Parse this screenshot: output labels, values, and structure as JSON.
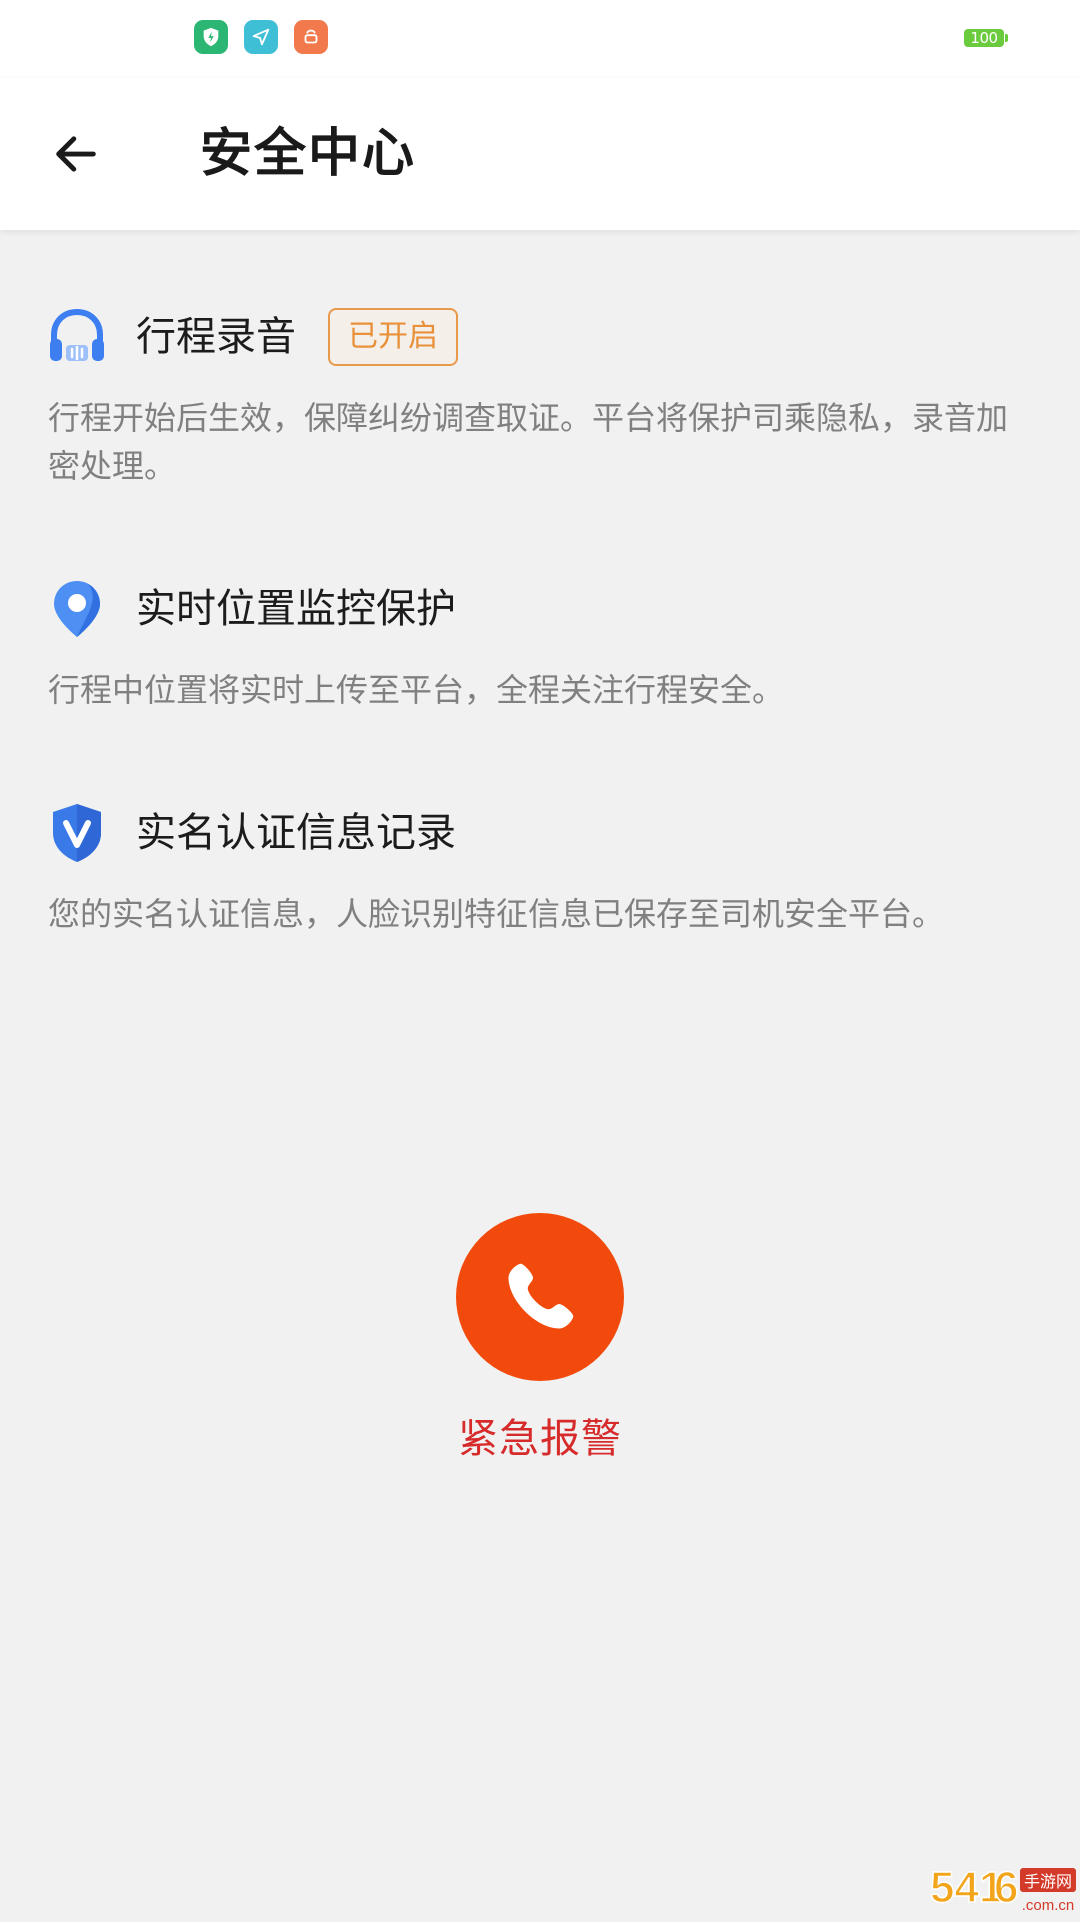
{
  "status_bar": {
    "battery_level": "100",
    "app_icons": [
      {
        "name": "shield-bolt-icon",
        "color": "#2bb673"
      },
      {
        "name": "send-icon",
        "color": "#3fbfd6"
      },
      {
        "name": "shopping-bag-icon",
        "color": "#f2794b"
      }
    ]
  },
  "header": {
    "title": "安全中心"
  },
  "features": [
    {
      "title": "行程录音",
      "badge": "已开启",
      "description": "行程开始后生效，保障纠纷调查取证。平台将保护司乘隐私，录音加密处理。",
      "icon": "headphones-icon"
    },
    {
      "title": "实时位置监控保护",
      "description": "行程中位置将实时上传至平台，全程关注行程安全。",
      "icon": "location-pin-icon"
    },
    {
      "title": "实名认证信息记录",
      "description": "您的实名认证信息，人脸识别特征信息已保存至司机安全平台。",
      "icon": "verified-shield-icon"
    }
  ],
  "emergency": {
    "label": "紧急报警",
    "color": "#f24a0c",
    "label_color": "#d72b2b"
  },
  "watermark": {
    "text": "5416手游网",
    "domain": ".com.cn"
  }
}
